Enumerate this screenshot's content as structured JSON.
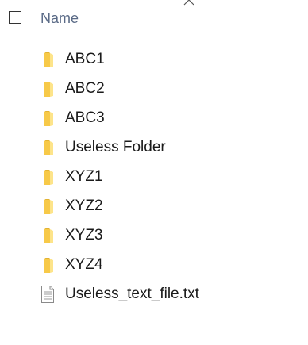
{
  "header": {
    "column_label": "Name",
    "column_color": "#5a6a86"
  },
  "files": [
    {
      "name": "ABC1",
      "type": "folder",
      "icon": "folder-icon"
    },
    {
      "name": "ABC2",
      "type": "folder",
      "icon": "folder-icon"
    },
    {
      "name": "ABC3",
      "type": "folder",
      "icon": "folder-icon"
    },
    {
      "name": "Useless Folder",
      "type": "folder",
      "icon": "folder-icon"
    },
    {
      "name": "XYZ1",
      "type": "folder",
      "icon": "folder-icon"
    },
    {
      "name": "XYZ2",
      "type": "folder",
      "icon": "folder-icon"
    },
    {
      "name": "XYZ3",
      "type": "folder",
      "icon": "folder-icon"
    },
    {
      "name": "XYZ4",
      "type": "folder",
      "icon": "folder-icon"
    },
    {
      "name": "Useless_text_file.txt",
      "type": "text",
      "icon": "text-file-icon"
    }
  ],
  "colors": {
    "folder_fill": "#f7c948",
    "folder_light": "#fde48a",
    "text": "#1a1a1a"
  }
}
